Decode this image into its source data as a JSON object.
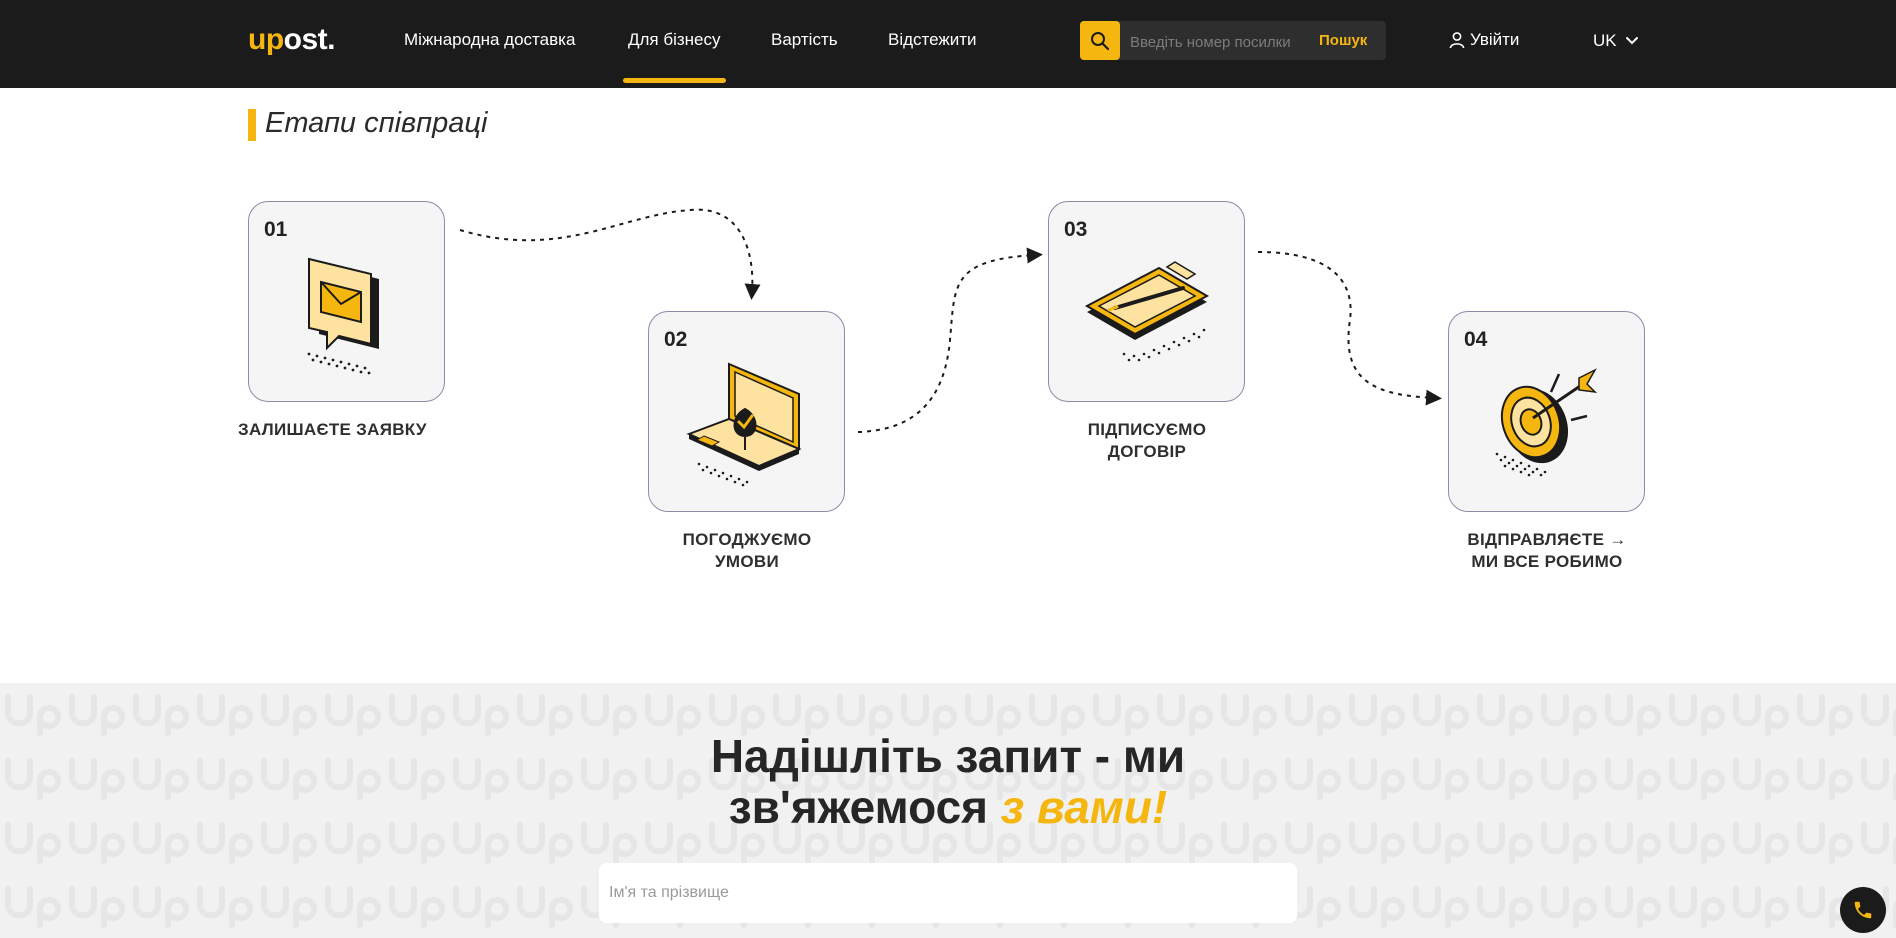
{
  "header": {
    "logo_prefix": "up",
    "logo_suffix": "ost.",
    "nav": [
      "Міжнародна доставка",
      "Для бізнесу",
      "Вартість",
      "Відстежити"
    ],
    "active_nav": "Для бізнесу",
    "search": {
      "placeholder": "Введіть номер посилки",
      "button": "Пошук"
    },
    "login": "Увійти",
    "language": "UK"
  },
  "stages": {
    "title": "Етапи співпраці",
    "items": [
      {
        "num": "01",
        "line1": "ЗАЛИШАЄТЕ ЗАЯВКУ",
        "line2": "",
        "icon": "speech-bubble-envelope-icon"
      },
      {
        "num": "02",
        "line1": "ПОГОДЖУЄМО",
        "line2": "УМОВИ",
        "icon": "laptop-location-pin-icon"
      },
      {
        "num": "03",
        "line1": "ПІДПИСУЄМО",
        "line2": "ДОГОВІР",
        "icon": "clipboard-pen-icon"
      },
      {
        "num": "04",
        "line1": "ВІДПРАВЛЯЄТЕ →",
        "line2": "МИ ВСЕ РОБИМО",
        "icon": "target-arrow-icon"
      }
    ]
  },
  "form": {
    "title_line1": "Надішліть запит - ми",
    "title_line2_plain": "зв'яжемося ",
    "title_line2_accent": "з вами!",
    "name_placeholder": "Ім'я та прізвище"
  },
  "colors": {
    "accent": "#f5b60f",
    "header_bg": "#1b1b1b",
    "section_bg": "#f1f1f1"
  }
}
